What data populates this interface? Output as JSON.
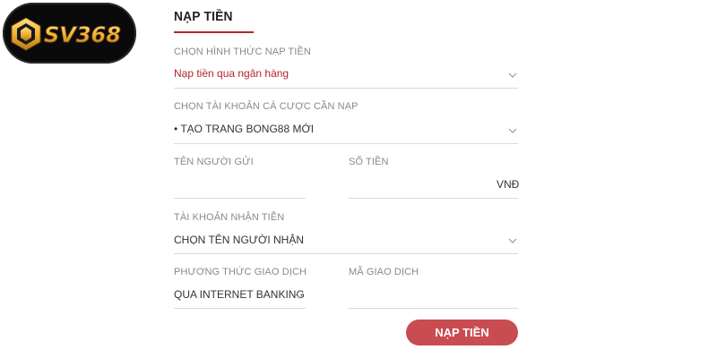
{
  "brand": {
    "logo_text": "SV368"
  },
  "form": {
    "title": "NẠP TIỀN",
    "deposit_method": {
      "label": "CHỌN HÌNH THỨC NẠP TIỀN",
      "value": "Nạp tiền qua ngân hàng"
    },
    "betting_account": {
      "label": "CHỌN TÀI KHOẢN CÁ CƯỢC CẦN NẠP",
      "value": "• TẠO TRANG BONG88 MỚI"
    },
    "sender_name": {
      "label": "TÊN NGƯỜI GỬI",
      "value": ""
    },
    "amount": {
      "label": "SỐ TIỀN",
      "value": "",
      "unit": "VNĐ"
    },
    "receiving_account": {
      "label": "TÀI KHOẢN NHẬN TIỀN",
      "value": "CHỌN TÊN NGƯỜI NHẬN"
    },
    "transaction_method": {
      "label": "PHƯƠNG THỨC GIAO DỊCH",
      "value": "QUA INTERNET BANKING"
    },
    "transaction_code": {
      "label": "MÃ GIAO DỊCH",
      "value": ""
    },
    "submit_label": "NẠP TIỀN"
  },
  "colors": {
    "accent": "#b3262e",
    "button": "#c84c50",
    "logo_gold": "#f2b233"
  },
  "icons": {
    "dropdown": "chevron-down-icon",
    "logo": "sv368-logo"
  }
}
